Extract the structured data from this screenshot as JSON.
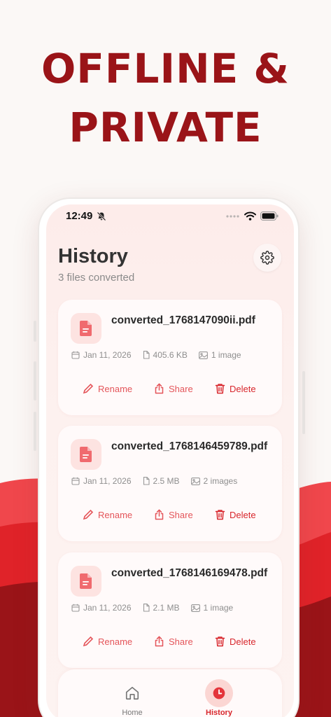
{
  "headline": {
    "line1": "OFFLINE &",
    "line2": "PRIVATE"
  },
  "status_bar": {
    "time": "12:49"
  },
  "header": {
    "title": "History",
    "subtitle": "3 files converted"
  },
  "colors": {
    "brand": "#9a1418",
    "accent": "#e4555a",
    "delete": "#d8262c"
  },
  "files": [
    {
      "name": "converted_1768147090ii.pdf",
      "date": "Jan 11, 2026",
      "size": "405.6 KB",
      "images": "1 image"
    },
    {
      "name": "converted_1768146459789.pdf",
      "date": "Jan 11, 2026",
      "size": "2.5 MB",
      "images": "2 images"
    },
    {
      "name": "converted_1768146169478.pdf",
      "date": "Jan 11, 2026",
      "size": "2.1 MB",
      "images": "1 image"
    }
  ],
  "actions": {
    "rename": "Rename",
    "share": "Share",
    "delete": "Delete"
  },
  "tabs": [
    {
      "label": "Home",
      "icon": "home-icon",
      "active": false
    },
    {
      "label": "History",
      "icon": "clock-icon",
      "active": true
    }
  ]
}
